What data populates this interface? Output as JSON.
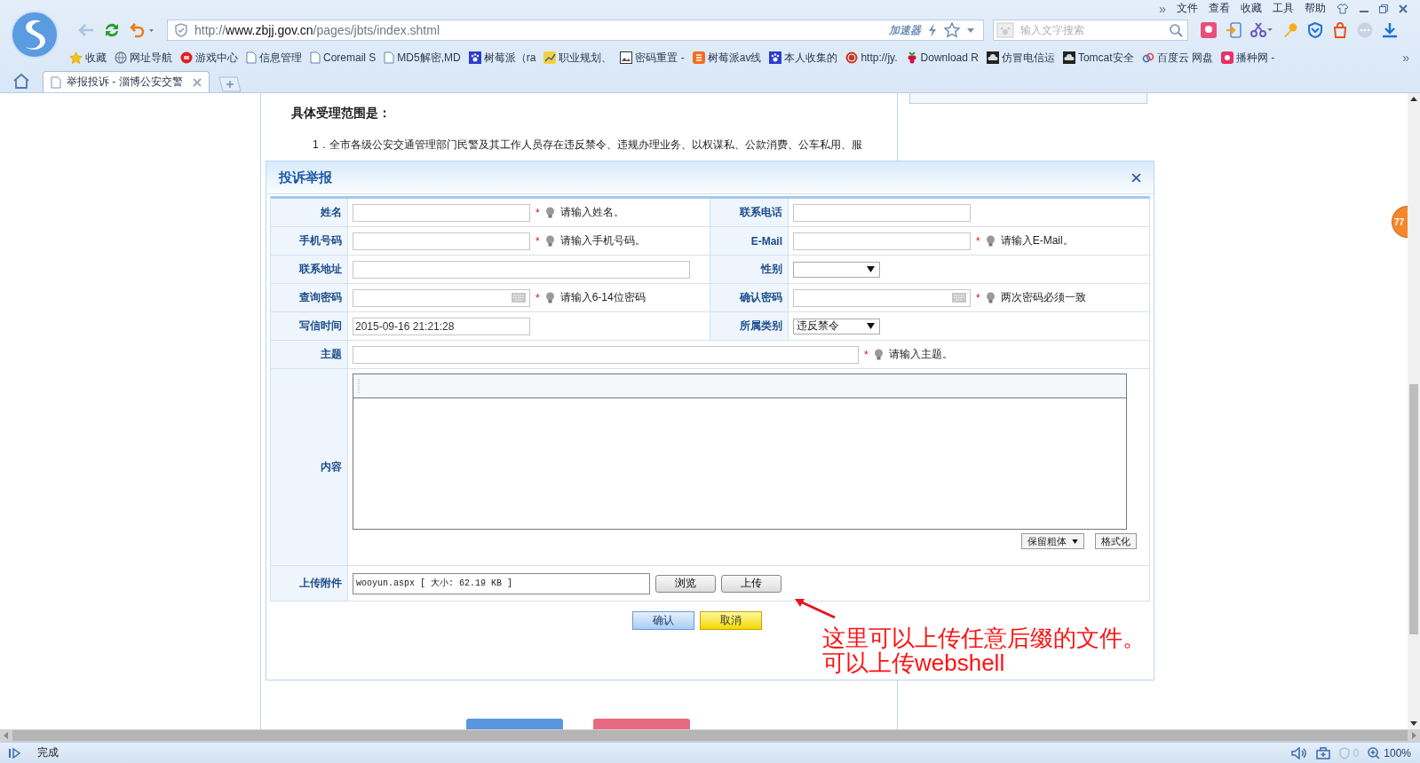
{
  "browser": {
    "menu_more": "»",
    "menu": [
      "文件",
      "查看",
      "收藏",
      "工具",
      "帮助"
    ],
    "url": {
      "scheme": "http://",
      "host": "www.zbjj.gov.cn",
      "path": "/pages/jbts/index.shtml"
    },
    "accelerator": "加速器",
    "search": {
      "placeholder": "输入文字搜索"
    },
    "bookmarks": [
      {
        "label": "收藏",
        "kind": "star"
      },
      {
        "label": "网址导航",
        "kind": "globe"
      },
      {
        "label": "游戏中心",
        "kind": "disc"
      },
      {
        "label": "信息管理",
        "kind": "page"
      },
      {
        "label": "Coremail S",
        "kind": "page"
      },
      {
        "label": "MD5解密,MD",
        "kind": "page"
      },
      {
        "label": "树莓派（ra",
        "kind": "paw"
      },
      {
        "label": "职业规划、",
        "kind": "chart"
      },
      {
        "label": "密码重置 -",
        "kind": "photo"
      },
      {
        "label": "树莓派av线",
        "kind": "tile"
      },
      {
        "label": "本人收集的",
        "kind": "paw"
      },
      {
        "label": "http://jy.",
        "kind": "seal"
      },
      {
        "label": "Download R",
        "kind": "berry"
      },
      {
        "label": "仿冒电信运",
        "kind": "cloud"
      },
      {
        "label": "Tomcat安全",
        "kind": "cloud"
      },
      {
        "label": "百度云 网盘",
        "kind": "link"
      },
      {
        "label": "播种网 -",
        "kind": "pink"
      }
    ],
    "bookmarks_more": "»",
    "tabs": [
      {
        "title": "举报投诉 - 淄博公安交警",
        "selected": true
      }
    ]
  },
  "page": {
    "heading": "具体受理范围是：",
    "item_1": "1．全市各级公安交通管理部门民警及其工作人员存在违反禁令、违规办理业务、以权谋私、公款消费、公车私用、服"
  },
  "dialog": {
    "title": "投诉举报",
    "fields": [
      {
        "label": "姓名",
        "kind": "text",
        "mark": "*",
        "hint": "请输入姓名。"
      },
      {
        "label": "联系电话",
        "kind": "text"
      },
      {
        "label": "手机号码",
        "kind": "text",
        "mark": "*",
        "hint": "请输入手机号码。"
      },
      {
        "label": "E-Mail",
        "kind": "text",
        "mark": "*",
        "hint": "请输入E-Mail。"
      },
      {
        "label": "联系地址",
        "kind": "long"
      },
      {
        "label": "性别",
        "kind": "select"
      },
      {
        "label": "查询密码",
        "kind": "password",
        "mark": "*",
        "hint": "请输入6-14位密码"
      },
      {
        "label": "确认密码",
        "kind": "password",
        "mark": "*",
        "hint": "两次密码必须一致"
      },
      {
        "label": "写信时间",
        "kind": "text",
        "value": "2015-09-16 21:21:28"
      },
      {
        "label": "所属类别",
        "kind": "select",
        "value": "违反禁令"
      }
    ],
    "subject": {
      "label": "主题",
      "mark": "*",
      "hint": "请输入主题。"
    },
    "content": {
      "label": "内容",
      "font_select": "保留粗体",
      "format_button": "格式化"
    },
    "attachment": {
      "label": "上传附件",
      "value": "wooyun.aspx [ 大小: 62.19 KB ]",
      "browse": "浏览",
      "upload": "上传"
    },
    "confirm": "确认",
    "cancel": "取消"
  },
  "annotation": {
    "lines": [
      "这里可以上传任意后缀的文件。",
      "可以上传webshell"
    ]
  },
  "badge": "77",
  "status_bar": {
    "text": "完成",
    "ad_count": "0",
    "zoom": "100%"
  }
}
